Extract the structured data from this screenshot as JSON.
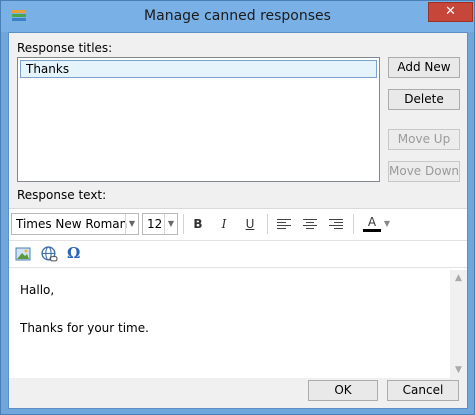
{
  "window": {
    "title": "Manage canned responses",
    "close_glyph": "✕"
  },
  "titles_section": {
    "label": "Response titles:",
    "items": [
      {
        "label": "Thanks",
        "selected": true
      }
    ]
  },
  "side_buttons": {
    "add_new": "Add New",
    "delete": "Delete",
    "move_up": "Move Up",
    "move_down": "Move Down"
  },
  "text_section": {
    "label": "Response text:"
  },
  "toolbar": {
    "font_family": "Times New Roman",
    "font_size": "12",
    "bold": "B",
    "italic": "I",
    "underline": "U",
    "text_color": "A",
    "icons": [
      "align-left-icon",
      "align-center-icon",
      "align-right-icon",
      "insert-image-icon",
      "insert-link-icon",
      "special-character-icon"
    ]
  },
  "insert_row": {
    "omega": "Ω"
  },
  "editor": {
    "lines": [
      "Hallo,",
      "Thanks for your time."
    ]
  },
  "footer": {
    "ok": "OK",
    "cancel": "Cancel"
  },
  "colors": {
    "titlebar": "#79b0e6",
    "close": "#c7463a",
    "selected_row": "#e5f3fb"
  }
}
